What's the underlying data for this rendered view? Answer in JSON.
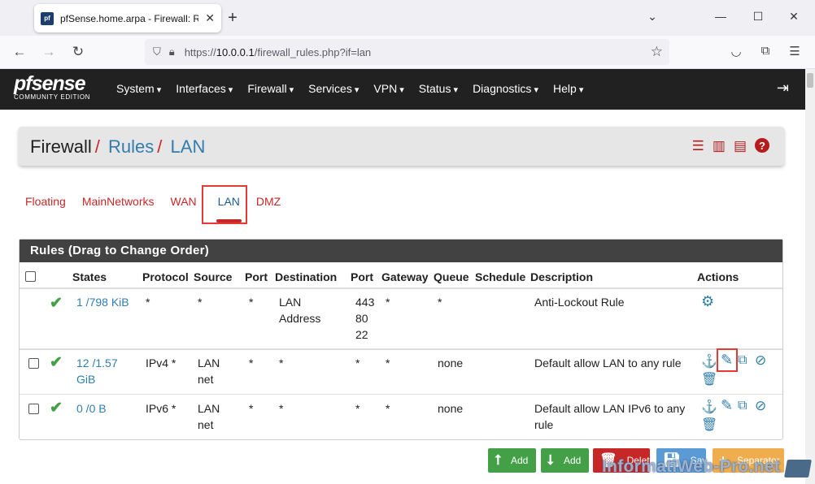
{
  "browser": {
    "tab_title": "pfSense.home.arpa - Firewall: R",
    "favicon_text": "pf",
    "url_prefix": "https://",
    "url_host": "10.0.0.1",
    "url_path": "/firewall_rules.php?if=lan"
  },
  "header": {
    "logo_text": "pfsense",
    "logo_sub": "COMMUNITY EDITION",
    "menu": [
      "System",
      "Interfaces",
      "Firewall",
      "Services",
      "VPN",
      "Status",
      "Diagnostics",
      "Help"
    ]
  },
  "breadcrumb": {
    "part1": "Firewall",
    "part2": "Rules",
    "part3": "LAN"
  },
  "tabs": [
    "Floating",
    "MainNetworks",
    "WAN",
    "LAN",
    "DMZ"
  ],
  "rules_panel": {
    "title": "Rules (Drag to Change Order)",
    "columns": [
      "States",
      "Protocol",
      "Source",
      "Port",
      "Destination",
      "Port",
      "Gateway",
      "Queue",
      "Schedule",
      "Description",
      "Actions"
    ],
    "rows": [
      {
        "states": "1 /798 KiB",
        "protocol": "*",
        "source": "*",
        "port": "*",
        "destination_l1": "LAN",
        "destination_l2": "Address",
        "dport_l1": "443",
        "dport_l2": "80",
        "dport_l3": "22",
        "gateway": "*",
        "queue": "*",
        "schedule": "",
        "description": "Anti-Lockout Rule"
      },
      {
        "states_l1": "12 /1.57",
        "states_l2": "GiB",
        "protocol": "IPv4 *",
        "source_l1": "LAN",
        "source_l2": "net",
        "port": "*",
        "destination": "*",
        "dport": "*",
        "gateway": "*",
        "queue": "none",
        "schedule": "",
        "description": "Default allow LAN to any rule"
      },
      {
        "states": "0 /0 B",
        "protocol": "IPv6 *",
        "source_l1": "LAN",
        "source_l2": "net",
        "port": "*",
        "destination": "*",
        "dport": "*",
        "gateway": "*",
        "queue": "none",
        "schedule": "",
        "description_l1": "Default allow LAN IPv6 to any",
        "description_l2": "rule"
      }
    ]
  },
  "buttons": {
    "add_top": "Add",
    "add_bottom": "Add",
    "delete": "Delete",
    "save": "Save",
    "separator": "Separator"
  },
  "watermark": "InformatiWeb-Pro.net",
  "colors": {
    "header_bg": "#212121",
    "accent_red": "#c62828",
    "link_blue": "#317eac",
    "enabled_green": "#43a047"
  }
}
